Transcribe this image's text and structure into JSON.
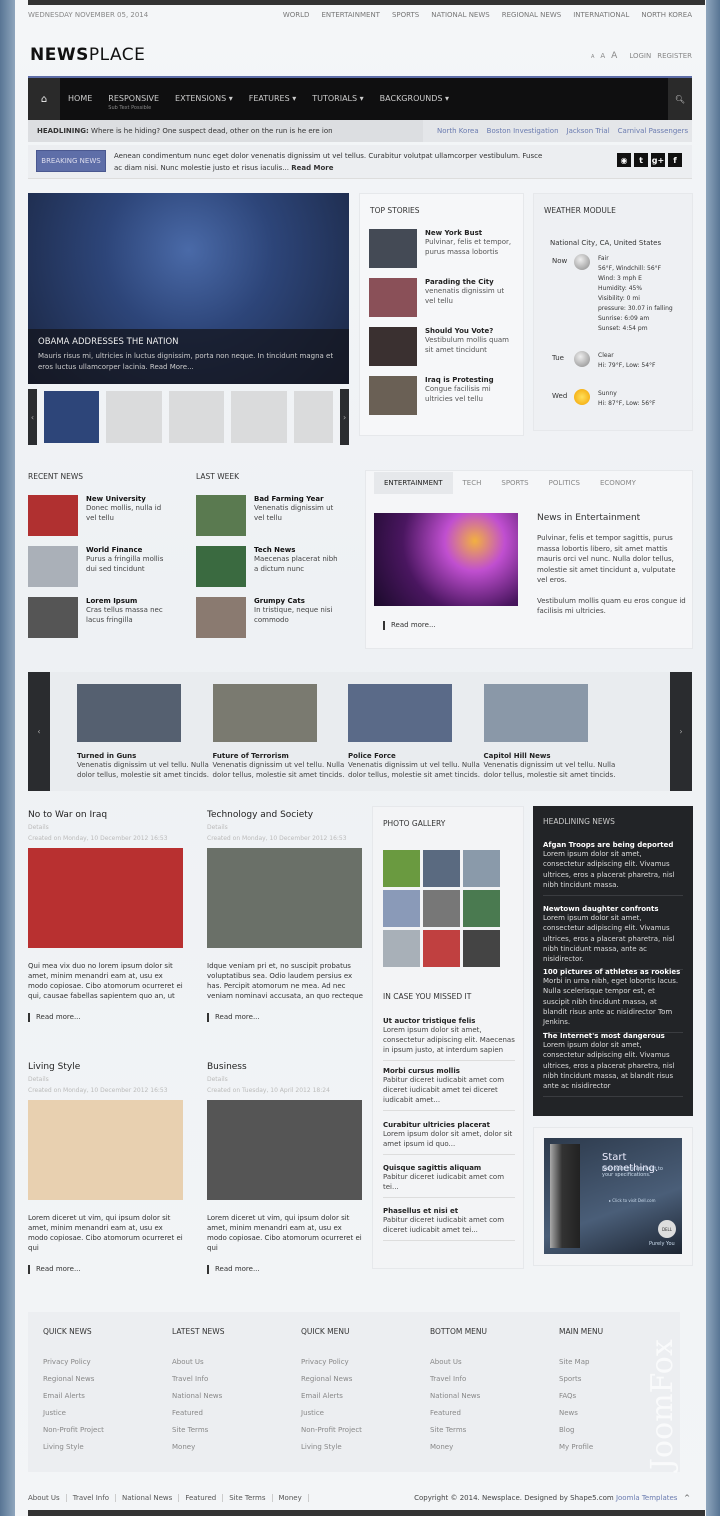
{
  "header": {
    "date": "WEDNESDAY NOVEMBER 05, 2014",
    "top_nav": [
      "WORLD",
      "ENTERTAINMENT",
      "SPORTS",
      "NATIONAL NEWS",
      "REGIONAL NEWS",
      "INTERNATIONAL",
      "NORTH KOREA"
    ],
    "logo_bold": "NEWS",
    "logo_light": "PLACE",
    "font_sizes": [
      "A",
      "A",
      "A"
    ],
    "login": "LOGIN",
    "register": "REGISTER"
  },
  "nav": {
    "items": [
      {
        "label": "HOME"
      },
      {
        "label": "RESPONSIVE",
        "sub": "Sub Text Possible"
      },
      {
        "label": "EXTENSIONS ▾"
      },
      {
        "label": "FEATURES ▾"
      },
      {
        "label": "TUTORIALS ▾"
      },
      {
        "label": "BACKGROUNDS ▾"
      }
    ],
    "accent": "#5e6ea8"
  },
  "headlining": {
    "label": "HEADLINING:",
    "text": "Where is he hiding? One suspect dead, other on the run is he ere ion",
    "links": [
      "North Korea",
      "Boston Investigation",
      "Jackson Trial",
      "Carnival Passengers"
    ]
  },
  "breaking": {
    "button": "BREAKING NEWS",
    "text": "Aenean condimentum nunc eget dolor venenatis dignissim ut vel tellus. Curabitur volutpat ullamcorper vestibulum. Fusce ac diam nisi. Nunc molestie justo et risus iaculis...",
    "read_more": "Read More",
    "social": [
      "rss-icon",
      "twitter-icon",
      "google-plus-icon",
      "facebook-icon"
    ]
  },
  "hero": {
    "title": "OBAMA ADDRESSES THE NATION",
    "text": "Mauris risus mi, ultricies in luctus dignissim, porta non neque. In tincidunt magna et eros luctus ullamcorper lacinia. Read More..."
  },
  "top_stories": {
    "title": "TOP STORIES",
    "items": [
      {
        "title": "New York Bust",
        "text": "Pulvinar, felis et tempor, purus massa lobortis"
      },
      {
        "title": "Parading the City",
        "text": "venenatis dignissim ut vel tellu"
      },
      {
        "title": "Should You Vote?",
        "text": "Vestibulum mollis quam sit amet tincidunt"
      },
      {
        "title": "Iraq is Protesting",
        "text": "Congue facilisis mi ultricies vel tellu"
      }
    ]
  },
  "weather": {
    "title": "WEATHER MODULE",
    "location": "National City, CA, United States",
    "days": [
      {
        "day": "Now",
        "icon": "moon",
        "lines": [
          "Fair",
          "56°F, Windchill: 56°F",
          "Wind: 3 mph E",
          "Humidity: 45%",
          "Visibility: 0 mi",
          "pressure: 30.07 in falling",
          "Sunrise: 6:09 am",
          "Sunset: 4:54 pm"
        ]
      },
      {
        "day": "Tue",
        "icon": "moon",
        "lines": [
          "Clear",
          "Hi: 79°F, Low: 54°F"
        ]
      },
      {
        "day": "Wed",
        "icon": "sun",
        "lines": [
          "Sunny",
          "Hi: 87°F, Low: 56°F"
        ]
      }
    ]
  },
  "recent": {
    "title": "RECENT NEWS",
    "items": [
      {
        "title": "New University",
        "text": "Donec mollis, nulla id vel tellu"
      },
      {
        "title": "World Finance",
        "text": "Purus a fringilla mollis dui sed tincidunt"
      },
      {
        "title": "Lorem Ipsum",
        "text": "Cras tellus massa nec lacus fringilla"
      }
    ]
  },
  "last_week": {
    "title": "LAST WEEK",
    "items": [
      {
        "title": "Bad Farming Year",
        "text": "Venenatis dignissim ut vel tellu"
      },
      {
        "title": "Tech News",
        "text": "Maecenas placerat nibh a dictum nunc"
      },
      {
        "title": "Grumpy Cats",
        "text": "In tristique, neque nisi commodo"
      }
    ]
  },
  "tabs": {
    "items": [
      "ENTERTAINMENT",
      "TECH",
      "SPORTS",
      "POLITICS",
      "ECONOMY"
    ],
    "active": "ENTERTAINMENT",
    "title": "News in Entertainment",
    "p1": "Pulvinar, felis et tempor sagittis, purus massa lobortis libero, sit amet mattis mauris orci vel nunc. Nulla dolor tellus, molestie sit amet tincidunt a, vulputate vel eros.",
    "p2": "Vestibulum mollis quam eu eros congue id facilisis mi ultricies.",
    "read_more": "Read more..."
  },
  "carousel": {
    "items": [
      {
        "title": "Turned in Guns",
        "text": "Venenatis dignissim ut vel tellu. Nulla dolor tellus, molestie sit amet tincids."
      },
      {
        "title": "Future of Terrorism",
        "text": "Venenatis dignissim ut vel tellu. Nulla dolor tellus, molestie sit amet tincids."
      },
      {
        "title": "Police Force",
        "text": "Venenatis dignissim ut vel tellu. Nulla dolor tellus, molestie sit amet tincids."
      },
      {
        "title": "Capitol Hill News",
        "text": "Venenatis dignissim ut vel tellu. Nulla dolor tellus, molestie sit amet tincids."
      }
    ]
  },
  "articles": [
    {
      "title": "No to War on Iraq",
      "details": "Details",
      "created": "Created on Monday, 10 December 2012 16:53",
      "text": "Qui mea vix duo no lorem ipsum dolor sit amet, minim menandri eam at, usu ex modo copiosae. Cibo atomorum ocurreret ei qui, causae fabellas sapientem quo an, ut",
      "read_more": "Read more..."
    },
    {
      "title": "Technology and Society",
      "details": "Details",
      "created": "Created on Monday, 10 December 2012 16:53",
      "text": "Idque veniam pri et, no suscipit probatus voluptatibus sea. Odio laudem persius ex has. Percipit atomorum ne mea. Ad nec veniam nominavi accusata, an quo recteque",
      "read_more": "Read more..."
    },
    {
      "title": "Living Style",
      "details": "Details",
      "created": "Created on Monday, 10 December 2012 16:53",
      "text": "Lorem diceret ut vim, qui ipsum dolor sit amet, minim menandri eam at, usu ex modo copiosae. Cibo atomorum ocurreret ei qui",
      "read_more": "Read more..."
    },
    {
      "title": "Business",
      "details": "Details",
      "created": "Created on Tuesday, 10 April 2012 18:24",
      "text": "Lorem diceret ut vim, qui ipsum dolor sit amet, minim menandri eam at, usu ex modo copiosae. Cibo atomorum ocurreret ei qui",
      "read_more": "Read more..."
    }
  ],
  "gallery": {
    "title": "PHOTO GALLERY"
  },
  "missed": {
    "title": "IN CASE YOU MISSED IT",
    "items": [
      {
        "title": "Ut auctor tristique felis",
        "text": "Lorem ipsum dolor sit amet, consectetur adipiscing elit. Maecenas in ipsum justo, at interdum sapien"
      },
      {
        "title": "Morbi cursus mollis",
        "text": "Pabitur diceret iudicabit amet com diceret iudicabit amet tei diceret iudicabit amet..."
      },
      {
        "title": "Curabitur ultricies placerat",
        "text": "Lorem ipsum dolor sit amet, dolor sit amet ipsum id quo..."
      },
      {
        "title": "Quisque sagittis aliquam",
        "text": "Pabitur diceret iudicabit amet com tei..."
      },
      {
        "title": "Phasellus et nisi et",
        "text": "Pabitur diceret iudicabit amet com diceret iudicabit amet tei..."
      }
    ]
  },
  "headlining_news": {
    "title": "HEADLINING NEWS",
    "items": [
      {
        "title": "Afgan Troops are being deported",
        "text": "Lorem ipsum dolor sit amet, consectetur adipiscing elit. Vivamus ultrices, eros a placerat pharetra, nisl nibh tincidunt massa."
      },
      {
        "title": "Newtown daughter confronts",
        "text": "Lorem ipsum dolor sit amet, consectetur adipiscing elit. Vivamus ultrices, eros a placerat pharetra, nisl nibh tincidunt massa, ante ac nisidirector."
      },
      {
        "title": "100 pictures of athletes as rookies",
        "text": "Morbi in urna nibh, eget lobortis lacus. Nulla scelerisque tempor est, et suscipit nibh tincidunt massa, at blandit risus ante ac nisidirector Tom Jenkins."
      },
      {
        "title": "The Internet's most dangerous",
        "text": "Lorem ipsum dolor sit amet, consectetur adipiscing elit. Vivamus ultrices, eros a placerat pharetra, nisl nibh tincidunt massa, at blandit risus ante ac nisidirector"
      }
    ]
  },
  "ad": {
    "headline": "Start something.",
    "sub": "Dell systems are built to your specifications.",
    "cta": "▸ Click to visit Dell.com",
    "brand": "DELL",
    "tagline": "Purely You"
  },
  "footer": {
    "columns": [
      {
        "title": "QUICK NEWS",
        "links": [
          "Privacy Policy",
          "Regional News",
          "Email Alerts",
          "Justice",
          "Non-Profit Project",
          "Living Style"
        ]
      },
      {
        "title": "LATEST NEWS",
        "links": [
          "About Us",
          "Travel Info",
          "National News",
          "Featured",
          "Site Terms",
          "Money"
        ]
      },
      {
        "title": "QUICK MENU",
        "links": [
          "Privacy Policy",
          "Regional News",
          "Email Alerts",
          "Justice",
          "Non-Profit Project",
          "Living Style"
        ]
      },
      {
        "title": "BOTTOM MENU",
        "links": [
          "About Us",
          "Travel Info",
          "National News",
          "Featured",
          "Site Terms",
          "Money"
        ]
      },
      {
        "title": "MAIN MENU",
        "links": [
          "Site Map",
          "Sports",
          "FAQs",
          "News",
          "Blog",
          "My Profile"
        ]
      }
    ],
    "bottom_links": [
      "About Us",
      "Travel Info",
      "National News",
      "Featured",
      "Site Terms",
      "Money"
    ],
    "copyright": "Copyright © 2014. Newsplace. Designed by Shape5.com",
    "copyright_link": "Joomla Templates",
    "top_arrow": "^"
  },
  "watermark": "JoomFox"
}
